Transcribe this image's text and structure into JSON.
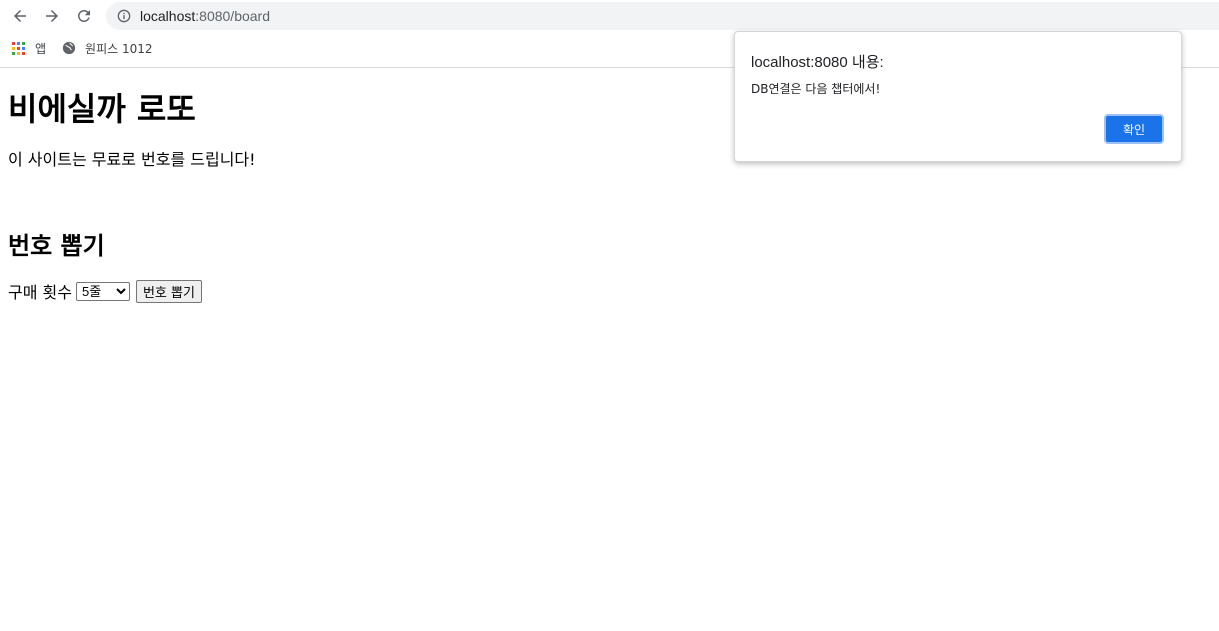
{
  "browser": {
    "url_host": "localhost",
    "url_rest": ":8080/board",
    "bookmarks": [
      {
        "label": "앱",
        "icon": "apps-grid-icon"
      },
      {
        "label": "원피스 1012",
        "icon": "globe-icon"
      }
    ],
    "colors": {
      "omnibox_bg": "#f1f3f4",
      "icon_gray": "#5f6368"
    }
  },
  "page": {
    "title": "비에실까 로또",
    "subtitle": "이 사이트는 무료로 번호를 드립니다!",
    "section_title": "번호 뽑기",
    "purchase_label": "구매 횟수",
    "count_select": {
      "selected": "5줄",
      "options": [
        "5줄"
      ]
    },
    "draw_button": "번호 뽑기"
  },
  "dialog": {
    "title": "localhost:8080 내용:",
    "message": "DB연결은 다음 챕터에서!",
    "ok_label": "확인",
    "ok_color": "#1a73e8"
  }
}
